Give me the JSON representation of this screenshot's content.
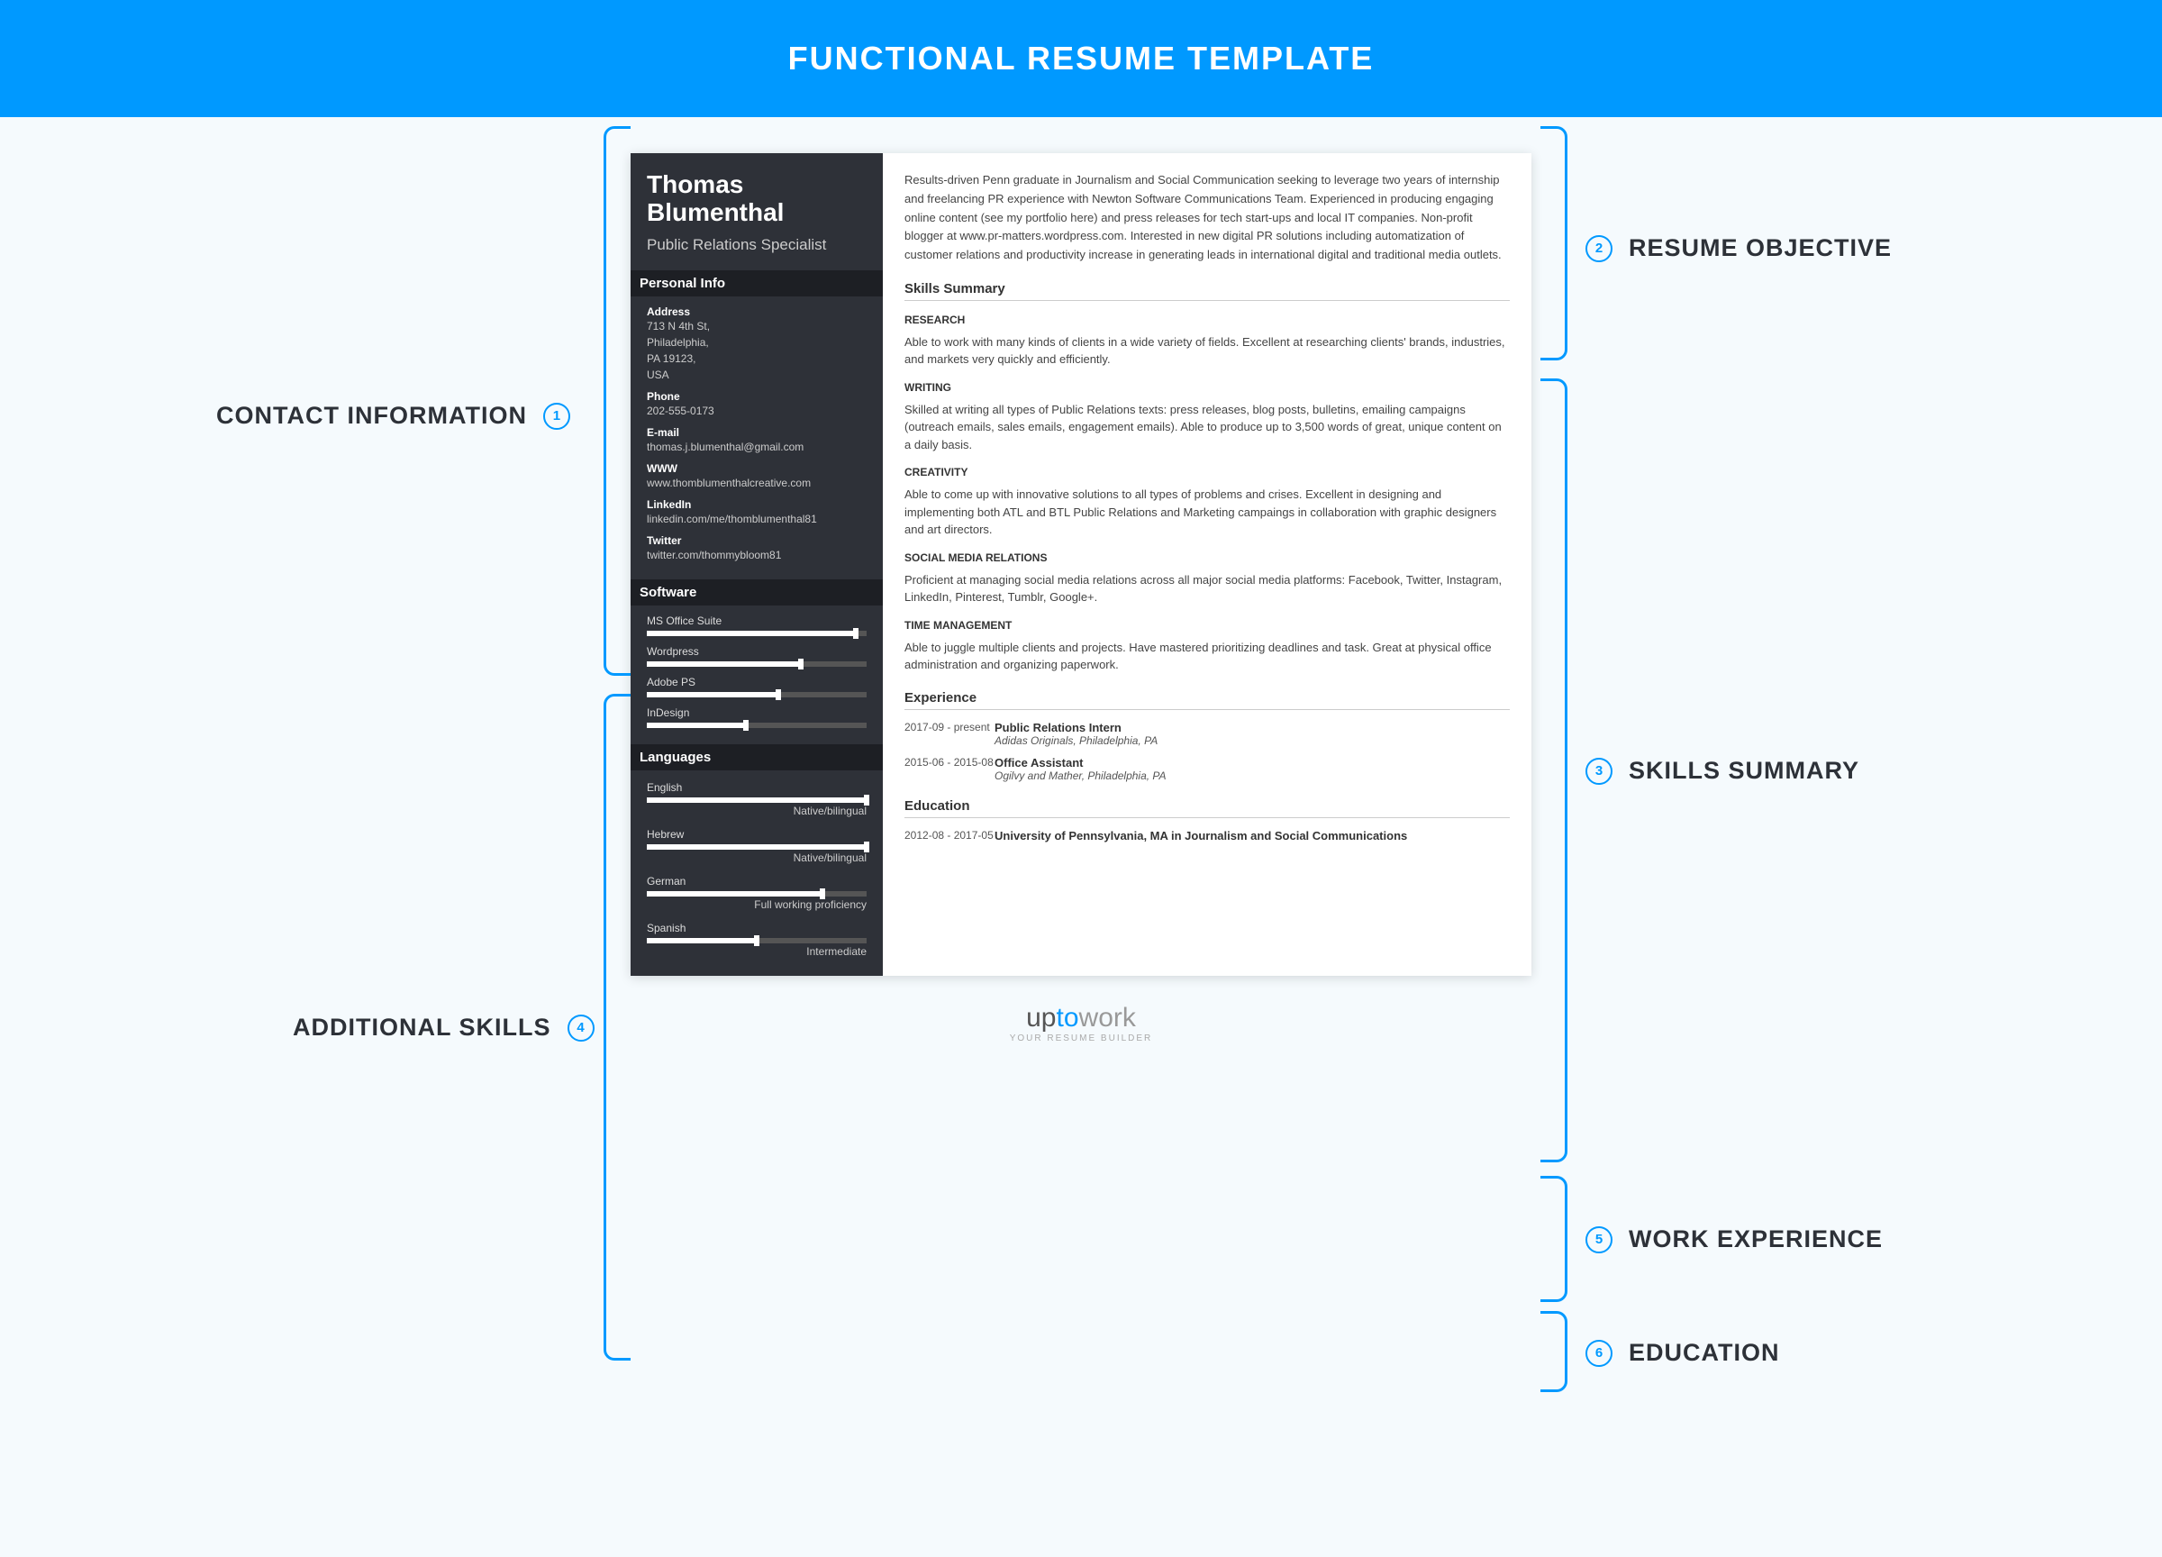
{
  "header": {
    "title": "FUNCTIONAL RESUME TEMPLATE"
  },
  "resume": {
    "name_first": "Thomas",
    "name_last": "Blumenthal",
    "job_title": "Public Relations Specialist",
    "personal_info_label": "Personal Info",
    "address_label": "Address",
    "address": "713 N 4th St,\nPhiladelphia,\nPA 19123,\nUSA",
    "phone_label": "Phone",
    "phone": "202-555-0173",
    "email_label": "E-mail",
    "email": "thomas.j.blumenthal@gmail.com",
    "www_label": "WWW",
    "www": "www.thomblumenthalcreative.com",
    "linkedin_label": "LinkedIn",
    "linkedin": "linkedin.com/me/thomblumenthal81",
    "twitter_label": "Twitter",
    "twitter": "twitter.com/thommybloom81",
    "software_label": "Software",
    "software": [
      {
        "name": "MS Office Suite",
        "level": 95
      },
      {
        "name": "Wordpress",
        "level": 70
      },
      {
        "name": "Adobe PS",
        "level": 60
      },
      {
        "name": "InDesign",
        "level": 45
      }
    ],
    "languages_label": "Languages",
    "languages": [
      {
        "name": "English",
        "level_pct": 100,
        "level": "Native/bilingual"
      },
      {
        "name": "Hebrew",
        "level_pct": 100,
        "level": "Native/bilingual"
      },
      {
        "name": "German",
        "level_pct": 80,
        "level": "Full working proficiency"
      },
      {
        "name": "Spanish",
        "level_pct": 50,
        "level": "Intermediate"
      }
    ],
    "objective": "Results-driven Penn graduate in Journalism and Social Communication seeking to leverage two years of internship and freelancing PR experience with Newton Software Communications Team. Experienced in producing engaging online content (see my portfolio here) and press releases for tech start-ups and local IT companies. Non-profit blogger at www.pr-matters.wordpress.com. Interested in new digital PR solutions including automatization of customer relations and productivity increase in generating leads in international digital and traditional media outlets.",
    "skills_summary_label": "Skills Summary",
    "skills": [
      {
        "heading": "RESEARCH",
        "text": "Able to work with many kinds of clients in a wide variety of fields. Excellent at researching clients' brands, industries, and markets very quickly and efficiently."
      },
      {
        "heading": "WRITING",
        "text": "Skilled at writing all types of Public Relations texts: press releases, blog posts, bulletins, emailing campaigns (outreach emails, sales emails, engagement emails). Able to produce up to 3,500 words of great, unique content on a daily basis."
      },
      {
        "heading": "CREATIVITY",
        "text": "Able to come up with innovative solutions to all types of problems and crises. Excellent in designing and implementing both ATL and BTL Public Relations and Marketing campaings in collaboration with graphic designers and art directors."
      },
      {
        "heading": "SOCIAL MEDIA RELATIONS",
        "text": "Proficient at managing social media relations across all major social media platforms: Facebook, Twitter, Instagram, LinkedIn, Pinterest, Tumblr, Google+."
      },
      {
        "heading": "TIME MANAGEMENT",
        "text": "Able to juggle multiple clients and projects. Have mastered prioritizing deadlines and task. Great at physical office administration and organizing paperwork."
      }
    ],
    "experience_label": "Experience",
    "experience": [
      {
        "dates": "2017-09 - present",
        "title": "Public Relations Intern",
        "company": "Adidas Originals, Philadelphia, PA"
      },
      {
        "dates": "2015-06 - 2015-08",
        "title": "Office Assistant",
        "company": "Ogilvy and Mather, Philadelphia, PA"
      }
    ],
    "education_label": "Education",
    "education": [
      {
        "dates": "2012-08 - 2017-05",
        "title": "University of Pennsylvania, MA in Journalism and Social Communications"
      }
    ]
  },
  "callouts": {
    "c1": {
      "num": "1",
      "label": "CONTACT INFORMATION"
    },
    "c2": {
      "num": "2",
      "label": "RESUME OBJECTIVE"
    },
    "c3": {
      "num": "3",
      "label": "SKILLS SUMMARY"
    },
    "c4": {
      "num": "4",
      "label": "ADDITIONAL SKILLS"
    },
    "c5": {
      "num": "5",
      "label": "WORK EXPERIENCE"
    },
    "c6": {
      "num": "6",
      "label": "EDUCATION"
    }
  },
  "footer": {
    "up": "up",
    "to": "to",
    "work": "work",
    "tagline": "YOUR RESUME BUILDER"
  }
}
